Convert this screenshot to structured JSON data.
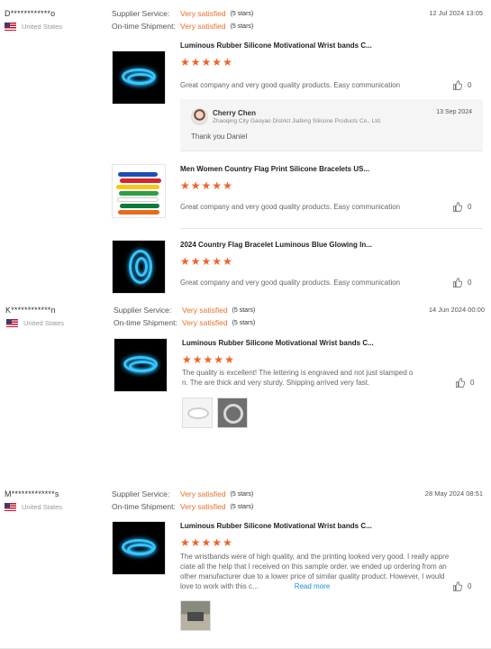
{
  "reviews": [
    {
      "user": "D************o",
      "country": "United States",
      "supplier_service_label": "Supplier Service:",
      "supplier_service_value": "Very satisfied",
      "supplier_service_stars": "(5 stars)",
      "shipment_label": "On-time Shipment:",
      "shipment_value": "Very satisfied",
      "shipment_stars": "(5 stars)",
      "date": "12 Jul 2024 13:05",
      "products": [
        {
          "title": "Luminous Rubber Silicone Motivational Wrist bands C...",
          "rating": 5,
          "text": "Great company and very good quality products. Easy communication",
          "likes": "0",
          "image": "glow-bracelets",
          "reply": {
            "name": "Cherry Chen",
            "company": "Zhaoqing City Gaoyao District Jiafeng Silicone Products Co., Ltd.",
            "date": "13 Sep 2024",
            "text": "Thank you Daniel"
          }
        },
        {
          "title": "Men Women Country Flag Print Silicone Bracelets US...",
          "rating": 5,
          "text": "Great company and very good quality products. Easy communication",
          "likes": "0",
          "image": "flag-bracelets"
        },
        {
          "title": "2024 Country Flag Bracelet Luminous Blue Glowing In...",
          "rating": 5,
          "text": "Great company and very good quality products. Easy communication",
          "likes": "0",
          "image": "glow-bracelet-blue"
        }
      ]
    },
    {
      "user": "K************n",
      "country": "United States",
      "supplier_service_label": "Supplier Service:",
      "supplier_service_value": "Very satisfied",
      "supplier_service_stars": "(5 stars)",
      "shipment_label": "On-time Shipment:",
      "shipment_value": "Very satisfied",
      "shipment_stars": "(5 stars)",
      "date": "14 Jun 2024 00:00",
      "products": [
        {
          "title": "Luminous Rubber Silicone Motivational Wrist bands C...",
          "rating": 5,
          "text_line1": "The quality is excellent! The lettering is engraved and not just stamped o",
          "text_line2": "n. The are thick and very sturdy. Shipping arrived very fast.",
          "likes": "0",
          "image": "glow-bracelets"
        }
      ]
    },
    {
      "user": "M*************s",
      "country": "United States",
      "supplier_service_label": "Supplier Service:",
      "supplier_service_value": "Very satisfied",
      "supplier_service_stars": "(5 stars)",
      "shipment_label": "On-time Shipment:",
      "shipment_value": "Very satisfied",
      "shipment_stars": "(5 stars)",
      "date": "28 May 2024 08:51",
      "products": [
        {
          "title": "Luminous Rubber Silicone Motivational Wrist bands C...",
          "rating": 5,
          "text_line1": "The wristbands were of high quality, and the printing looked very good. I really appre",
          "text_line2": "ciate all the help that I received on this sample order. we ended up ordering from an",
          "text_line3": "other manufacturer due to a lower price of similar quality product. However, I would",
          "text_line4": "love to work with this c...",
          "read_more": "Read more",
          "likes": "0",
          "image": "glow-bracelets"
        }
      ]
    }
  ],
  "colors": {
    "accent_orange": "#e8702a",
    "star_orange": "#f0622a",
    "link_blue": "#1a8fd8",
    "glow_blue": "#35c8ff"
  },
  "icons": {
    "star": "★",
    "like": "thumbs-up-icon",
    "flag": "us-flag-icon"
  }
}
